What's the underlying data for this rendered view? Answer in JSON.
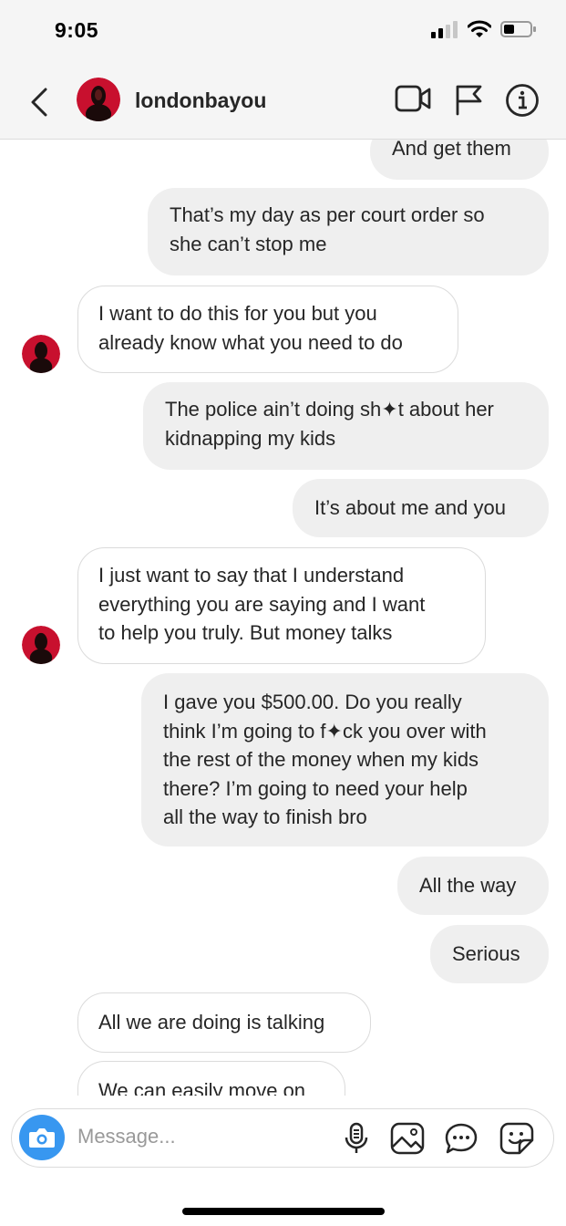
{
  "status_bar": {
    "time": "9:05"
  },
  "header": {
    "username": "londonbayou",
    "icons": [
      "back-chevron-icon",
      "video-call-icon",
      "flag-icon",
      "info-icon"
    ]
  },
  "messages": [
    {
      "from": "me",
      "text": "And get them"
    },
    {
      "from": "me",
      "text": "That’s my day as per court order so\nshe can’t stop me"
    },
    {
      "from": "them",
      "text": "I want to do this for you but you\nalready know what you need to do"
    },
    {
      "from": "me",
      "text": "The police ain’t doing sh✦t about her\nkidnapping my kids"
    },
    {
      "from": "me",
      "text": "It’s about me and you"
    },
    {
      "from": "them",
      "text": "I just want to say that I understand\neverything you are saying and I want\nto help you truly. But money talks"
    },
    {
      "from": "me",
      "text": "I gave you $500.00.  Do you really\nthink I’m going to f✦ck you over with\nthe rest of the money when my kids\nthere?  I’m going to need your help\nall the way to finish bro"
    },
    {
      "from": "me",
      "text": "All the way"
    },
    {
      "from": "me",
      "text": "Serious"
    },
    {
      "from": "them",
      "text": "All we are doing is talking"
    },
    {
      "from": "them",
      "text": "We can easily move on"
    }
  ],
  "composer": {
    "placeholder": "Message...",
    "icons": [
      "camera-icon",
      "microphone-icon",
      "gallery-icon",
      "chat-bubble-icon",
      "sticker-icon"
    ]
  },
  "colors": {
    "sent_bubble": "#efefef",
    "received_border": "#dbdbdb",
    "camera_blue": "#3897f0",
    "avatar_red": "#c8102e"
  }
}
